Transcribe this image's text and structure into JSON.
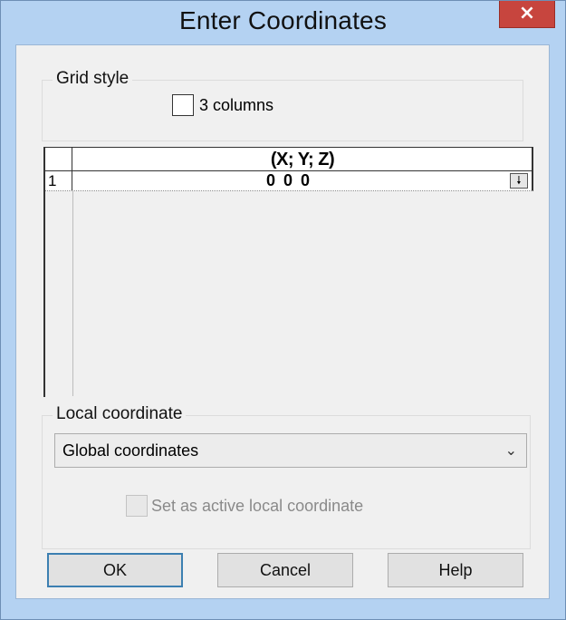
{
  "window": {
    "title": "Enter Coordinates",
    "close_label": "×"
  },
  "grid_style": {
    "legend": "Grid style",
    "checkbox_label": "3 columns",
    "checked": false
  },
  "coordinates_grid": {
    "column_header": "(X; Y; Z)",
    "rows": [
      {
        "number": "1",
        "value": "0 0 0",
        "button_icon": "arrow-down-icon",
        "button_glyph": "🠗"
      }
    ]
  },
  "local_coordinate": {
    "legend": "Local coordinate",
    "selected": "Global coordinates",
    "dropdown_glyph": "⌄",
    "active_checkbox_label": "Set as active local coordinate",
    "active_checkbox_enabled": false
  },
  "buttons": {
    "ok": "OK",
    "cancel": "Cancel",
    "help": "Help"
  },
  "colors": {
    "title_bar": "#b4d2f2",
    "close_button": "#c7453e",
    "dialog_background": "#f0f0f0",
    "default_button_border": "#3c7fb1"
  }
}
